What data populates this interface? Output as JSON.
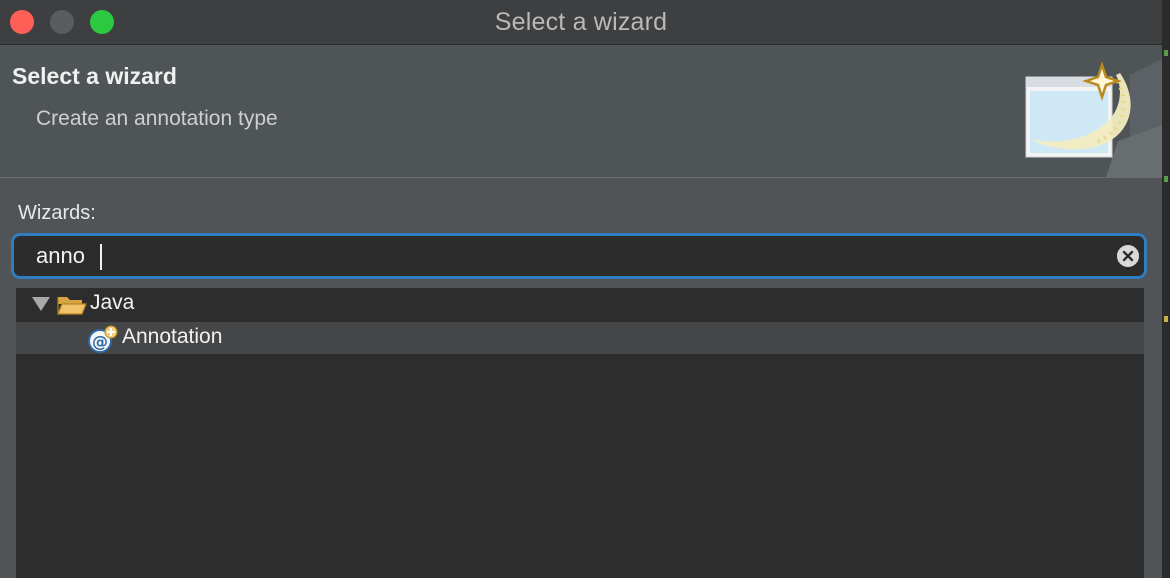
{
  "window": {
    "title": "Select a wizard",
    "controls": [
      "close",
      "minimize",
      "zoom"
    ]
  },
  "header": {
    "title": "Select a wizard",
    "description": "Create an annotation type",
    "graphic_icon": "new-wizard-icon"
  },
  "wizards": {
    "label": "Wizards:",
    "filter": {
      "value": "anno",
      "placeholder": "",
      "clear_icon": "clear-icon"
    },
    "tree": [
      {
        "label": "Java",
        "icon": "open-folder-icon",
        "expanded": true,
        "children": [
          {
            "label": "Annotation",
            "icon": "annotation-icon",
            "selected": true
          }
        ]
      }
    ]
  },
  "colors": {
    "accent": "#2f7ec0",
    "close": "#fe5f57",
    "zoom": "#2ac940"
  }
}
